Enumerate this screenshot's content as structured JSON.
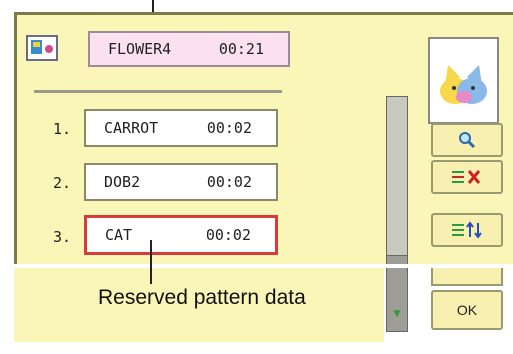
{
  "current": {
    "name": "FLOWER4",
    "time": "00:21"
  },
  "reserved": [
    {
      "num": "1.",
      "name": "CARROT",
      "time": "00:02"
    },
    {
      "num": "2.",
      "name": "DOB2",
      "time": "00:02"
    },
    {
      "num": "3.",
      "name": "CAT",
      "time": "00:02"
    }
  ],
  "selected_index": 2,
  "caption": "Reserved pattern data",
  "ok_label": "OK",
  "colors": {
    "panel": "#f9f6b8",
    "selected_border": "#d93b3b",
    "header_bg": "#fbe1f0"
  }
}
